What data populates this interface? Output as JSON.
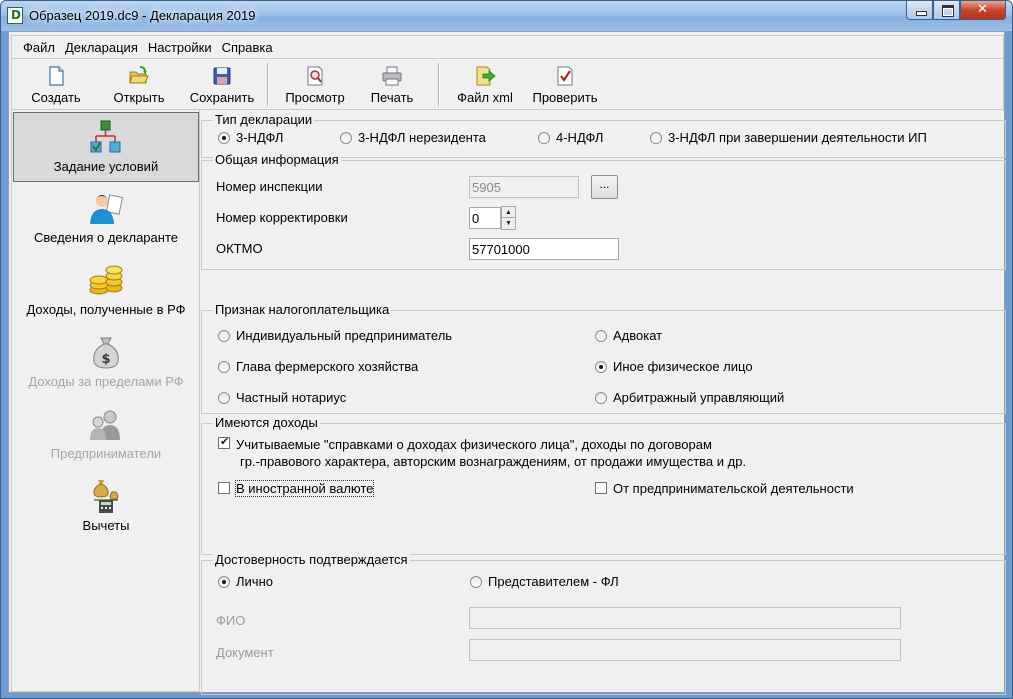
{
  "window": {
    "title": "Образец 2019.dc9 - Декларация 2019"
  },
  "menu": [
    "Файл",
    "Декларация",
    "Настройки",
    "Справка"
  ],
  "toolbar": {
    "create": "Создать",
    "open": "Открыть",
    "save": "Сохранить",
    "preview": "Просмотр",
    "print": "Печать",
    "xml": "Файл xml",
    "check": "Проверить"
  },
  "sidebar": {
    "items": [
      {
        "label": "Задание условий",
        "icon": "tree-structure-icon",
        "active": true,
        "disabled": false
      },
      {
        "label": "Сведения о декларанте",
        "icon": "person-document-icon",
        "active": false,
        "disabled": false
      },
      {
        "label": "Доходы, полученные в РФ",
        "icon": "coins-icon",
        "active": false,
        "disabled": false
      },
      {
        "label": "Доходы за пределами РФ",
        "icon": "money-bag-icon",
        "active": false,
        "disabled": true
      },
      {
        "label": "Предприниматели",
        "icon": "businessman-icon",
        "active": false,
        "disabled": true
      },
      {
        "label": "Вычеты",
        "icon": "scales-calculator-icon",
        "active": false,
        "disabled": false
      }
    ]
  },
  "declaration_type": {
    "title": "Тип декларации",
    "options": [
      {
        "label": "3-НДФЛ",
        "selected": true
      },
      {
        "label": "3-НДФЛ нерезидента",
        "selected": false
      },
      {
        "label": "4-НДФЛ",
        "selected": false
      },
      {
        "label": "3-НДФЛ при завершении деятельности ИП",
        "selected": false
      }
    ]
  },
  "general_info": {
    "title": "Общая информация",
    "inspection_label": "Номер инспекции",
    "inspection_value": "5905",
    "browse_label": "...",
    "correction_label": "Номер корректировки",
    "correction_value": "0",
    "oktmo_label": "ОКТМО",
    "oktmo_value": "57701000"
  },
  "taxpayer": {
    "title": "Признак налогоплательщика",
    "options": [
      {
        "label": "Индивидуальный предприниматель",
        "selected": false
      },
      {
        "label": "Адвокат",
        "selected": false
      },
      {
        "label": "Глава фермерского хозяйства",
        "selected": false
      },
      {
        "label": "Иное физическое лицо",
        "selected": true
      },
      {
        "label": "Частный нотариус",
        "selected": false
      },
      {
        "label": "Арбитражный управляющий",
        "selected": false
      }
    ]
  },
  "income": {
    "title": "Имеются доходы",
    "certificates_line1": "Учитываемые \"справками о доходах физического лица\", доходы по договорам",
    "certificates_line2": "гр.-правового характера, авторским вознаграждениям, от продажи имущества и др.",
    "certificates_checked": true,
    "foreign_currency": "В иностранной валюте",
    "foreign_currency_checked": false,
    "business": "От предпринимательской деятельности",
    "business_checked": false
  },
  "confirmation": {
    "title": "Достоверность подтверждается",
    "personal": "Лично",
    "personal_selected": true,
    "representative": "Представителем - ФЛ",
    "representative_selected": false,
    "fio_label": "ФИО",
    "fio_value": "",
    "document_label": "Документ",
    "document_value": ""
  }
}
